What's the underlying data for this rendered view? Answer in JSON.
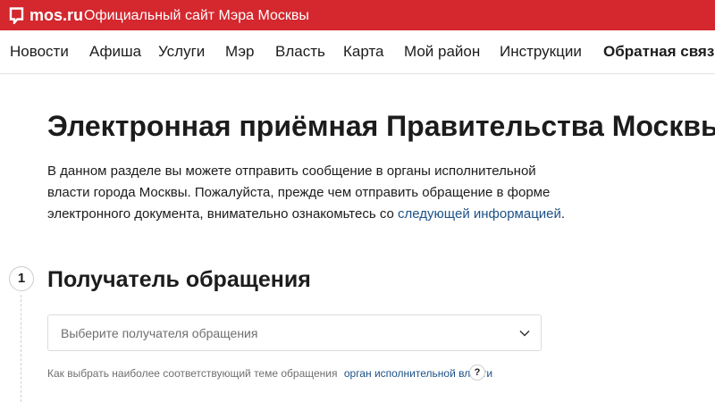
{
  "header": {
    "logo_text": "mos.ru",
    "site_title": "Официальный сайт Мэра Москвы"
  },
  "nav": {
    "items": [
      {
        "label": "Новости"
      },
      {
        "label": "Афиша"
      },
      {
        "label": "Услуги"
      },
      {
        "label": "Мэр"
      },
      {
        "label": "Власть"
      },
      {
        "label": "Карта"
      },
      {
        "label": "Мой район"
      },
      {
        "label": "Инструкции"
      },
      {
        "label": "Обратная связь",
        "active": true
      }
    ]
  },
  "page": {
    "title": "Электронная приёмная Правительства Москвы",
    "intro_line1": "В данном разделе вы можете отправить сообщение в органы исполнительной",
    "intro_line2": "власти города Москвы. Пожалуйста, прежде чем отправить обращение в форме",
    "intro_line3": "электронного документа, внимательно ознакомьтесь со",
    "intro_link": "следующей информацией",
    "intro_end": "."
  },
  "step1": {
    "number": "1",
    "title": "Получатель обращения",
    "select_placeholder": "Выберите получателя обращения",
    "hint_text": "Как выбрать наиболее соответствующий теме обращения",
    "hint_link": "орган исполнительной власти",
    "help_symbol": "?"
  },
  "colors": {
    "brand_red": "#d4272e",
    "link_blue": "#1c5187"
  },
  "icons": {
    "logo": "speech-bubble-icon",
    "select": "chevron-down-icon",
    "help": "question-icon"
  }
}
